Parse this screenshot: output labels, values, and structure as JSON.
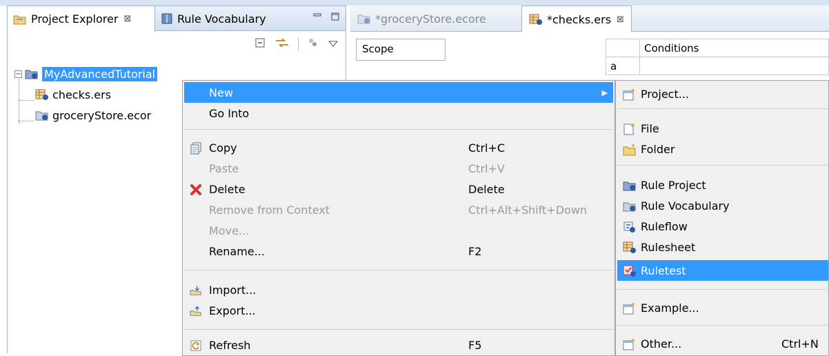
{
  "explorer": {
    "tabs": [
      {
        "label": "Project Explorer",
        "close": "⊠",
        "active": true
      },
      {
        "label": "Rule Vocabulary",
        "active": false
      }
    ],
    "tree": {
      "project": "MyAdvancedTutorial",
      "children": [
        "checks.ers",
        "groceryStore.ecor"
      ]
    }
  },
  "editor": {
    "tabs": [
      {
        "label": "*groceryStore.ecore",
        "active": false
      },
      {
        "label": "*checks.ers",
        "close": "⊠",
        "active": true
      }
    ],
    "scope_label": "Scope",
    "conditions_header": "Conditions",
    "row_a": "a"
  },
  "context_menu": {
    "items": [
      {
        "label": "New",
        "shortcut": "",
        "state": "highlighted",
        "icon": "none",
        "submenu": true
      },
      {
        "label": "Go Into",
        "shortcut": "",
        "state": "enabled",
        "icon": "none"
      },
      {
        "label": "Copy",
        "shortcut": "Ctrl+C",
        "state": "enabled",
        "icon": "copy-icon"
      },
      {
        "label": "Paste",
        "shortcut": "Ctrl+V",
        "state": "disabled",
        "icon": "none"
      },
      {
        "label": "Delete",
        "shortcut": "Delete",
        "state": "enabled",
        "icon": "delete-icon"
      },
      {
        "label": "Remove from Context",
        "shortcut": "Ctrl+Alt+Shift+Down",
        "state": "disabled",
        "icon": "none"
      },
      {
        "label": "Move...",
        "shortcut": "",
        "state": "disabled",
        "icon": "none"
      },
      {
        "label": "Rename...",
        "shortcut": "F2",
        "state": "enabled",
        "icon": "none"
      },
      {
        "label": "Import...",
        "shortcut": "",
        "state": "enabled",
        "icon": "import-icon"
      },
      {
        "label": "Export...",
        "shortcut": "",
        "state": "enabled",
        "icon": "export-icon"
      },
      {
        "label": "Refresh",
        "shortcut": "F5",
        "state": "enabled",
        "icon": "refresh-icon"
      }
    ]
  },
  "submenu": {
    "items": [
      {
        "label": "Project...",
        "shortcut": "",
        "icon": "new-project-icon",
        "state": "enabled"
      },
      {
        "label": "File",
        "shortcut": "",
        "icon": "new-file-icon",
        "state": "enabled"
      },
      {
        "label": "Folder",
        "shortcut": "",
        "icon": "new-folder-icon",
        "state": "enabled"
      },
      {
        "label": "Rule Project",
        "shortcut": "",
        "icon": "rule-project-icon",
        "state": "enabled"
      },
      {
        "label": "Rule Vocabulary",
        "shortcut": "",
        "icon": "rule-vocabulary-icon",
        "state": "enabled"
      },
      {
        "label": "Ruleflow",
        "shortcut": "",
        "icon": "ruleflow-icon",
        "state": "enabled"
      },
      {
        "label": "Rulesheet",
        "shortcut": "",
        "icon": "rulesheet-icon",
        "state": "enabled"
      },
      {
        "label": "Ruletest",
        "shortcut": "",
        "icon": "ruletest-icon",
        "state": "highlighted"
      },
      {
        "label": "Example...",
        "shortcut": "",
        "icon": "example-icon",
        "state": "enabled"
      },
      {
        "label": "Other...",
        "shortcut": "Ctrl+N",
        "icon": "other-wizard-icon",
        "state": "enabled"
      }
    ]
  },
  "colors": {
    "selection": "#3399ff",
    "menu_bg": "#f0f0f0",
    "disabled_text": "#9a9a9a",
    "delete_red": "#d9302a"
  }
}
